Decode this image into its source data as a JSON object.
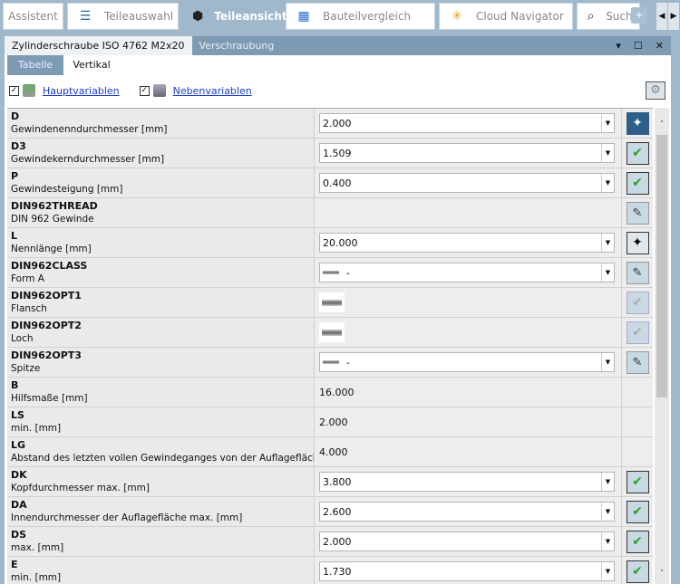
{
  "tabs": [
    {
      "label": "Assistent",
      "icon": "none"
    },
    {
      "label": "Teileauswahl",
      "icon": "stack-icon"
    },
    {
      "label": "Teileansicht",
      "icon": "cube-icon",
      "active": true
    },
    {
      "label": "Bauteilvergleich",
      "icon": "compare-icon"
    },
    {
      "label": "Cloud Navigator",
      "icon": "network-icon"
    },
    {
      "label": "Suche",
      "icon": "search-icon"
    }
  ],
  "add_tab": "+",
  "doc_tabs": [
    "Zylinderschraube ISO 4762 M2x20",
    "Verschraubung"
  ],
  "sub_tabs": [
    "Tabelle",
    "Vertikal"
  ],
  "toolbar": {
    "main_vars": "Hauptvariablen",
    "sub_vars": "Nebenvariablen"
  },
  "rows": [
    {
      "name": "D",
      "desc": "Gewindenenndurchmesser [mm]",
      "type": "combo",
      "value": "2.000",
      "action": "pin-active"
    },
    {
      "name": "D3",
      "desc": "Gewindekerndurchmesser [mm]",
      "type": "combo",
      "value": "1.509",
      "action": "check"
    },
    {
      "name": "P",
      "desc": "Gewindesteigung [mm]",
      "type": "combo",
      "value": "0.400",
      "action": "check"
    },
    {
      "name": "DIN962THREAD",
      "desc": "DIN 962 Gewinde",
      "type": "empty",
      "value": "",
      "action": "edit"
    },
    {
      "name": "L",
      "desc": "Nennlänge [mm]",
      "type": "combo",
      "value": "20.000",
      "action": "pin"
    },
    {
      "name": "DIN962CLASS",
      "desc": "Form A",
      "type": "combo-img",
      "value": "-",
      "action": "edit"
    },
    {
      "name": "DIN962OPT1",
      "desc": "Flansch",
      "type": "img",
      "value": "",
      "action": "check-disabled"
    },
    {
      "name": "DIN962OPT2",
      "desc": "Loch",
      "type": "img",
      "value": "",
      "action": "check-disabled"
    },
    {
      "name": "DIN962OPT3",
      "desc": "Spitze",
      "type": "combo-img",
      "value": "-",
      "action": "edit"
    },
    {
      "name": "B",
      "desc": "Hilfsmaße [mm]",
      "type": "text",
      "value": "16.000",
      "action": "none"
    },
    {
      "name": "LS",
      "desc": "min. [mm]",
      "type": "text",
      "value": "2.000",
      "action": "none"
    },
    {
      "name": "LG",
      "desc": "Abstand des letzten vollen Gewindeganges von der Auflagefläche (Schaft)",
      "type": "text",
      "value": "4.000",
      "action": "none"
    },
    {
      "name": "DK",
      "desc": "Kopfdurchmesser max. [mm]",
      "type": "combo",
      "value": "3.800",
      "action": "check"
    },
    {
      "name": "DA",
      "desc": "Innendurchmesser der Auflagefläche max. [mm]",
      "type": "combo",
      "value": "2.600",
      "action": "check"
    },
    {
      "name": "DS",
      "desc": "max. [mm]",
      "type": "combo",
      "value": "2.000",
      "action": "check"
    },
    {
      "name": "E",
      "desc": "min. [mm]",
      "type": "combo",
      "value": "1.730",
      "action": "check"
    }
  ]
}
